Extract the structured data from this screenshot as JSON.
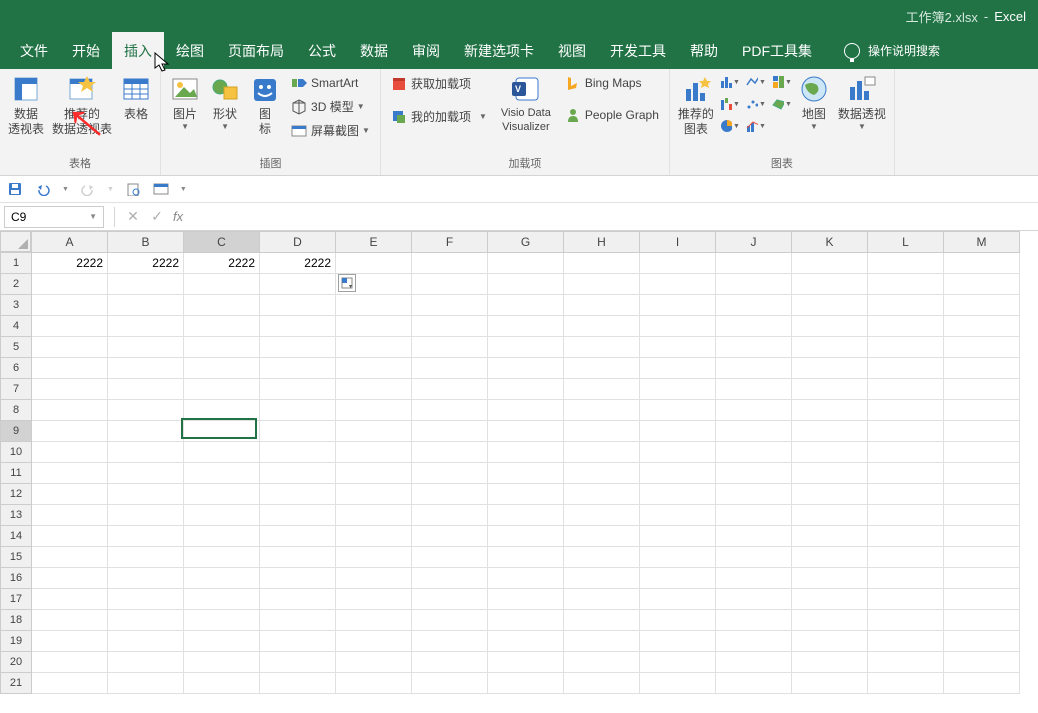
{
  "title": {
    "filename": "工作簿2.xlsx",
    "sep": "-",
    "appname": "Excel"
  },
  "tabs": {
    "file": "文件",
    "home": "开始",
    "insert": "插入",
    "draw": "绘图",
    "pagelayout": "页面布局",
    "formulas": "公式",
    "data": "数据",
    "review": "审阅",
    "newtab": "新建选项卡",
    "view": "视图",
    "developer": "开发工具",
    "help": "帮助",
    "pdftools": "PDF工具集",
    "tellme": "操作说明搜索"
  },
  "ribbon": {
    "groups": {
      "tables": "表格",
      "illustrations": "插图",
      "addins": "加载项",
      "charts": "图表"
    },
    "labels": {
      "pivottable": "数据\n透视表",
      "recpivot": "推荐的\n数据透视表",
      "table": "表格",
      "pictures": "图片",
      "shapes": "形状",
      "icons": "图\n标",
      "smartart": "SmartArt",
      "model3d": "3D 模型",
      "screenshot": "屏幕截图",
      "getaddins": "获取加载项",
      "myaddins": "我的加载项",
      "visio": "Visio Data\nVisualizer",
      "bingmaps": "Bing Maps",
      "peoplegraph": "People Graph",
      "recchart": "推荐的\n图表",
      "maps": "地图",
      "pivotchart": "数据透视"
    }
  },
  "namebox": "C9",
  "columns": [
    "A",
    "B",
    "C",
    "D",
    "E",
    "F",
    "G",
    "H",
    "I",
    "J",
    "K",
    "L",
    "M"
  ],
  "rows": 21,
  "cells": {
    "A1": "2222",
    "B1": "2222",
    "C1": "2222",
    "D1": "2222"
  },
  "selected": {
    "col": "C",
    "row": 9
  },
  "highlightRow": 1
}
